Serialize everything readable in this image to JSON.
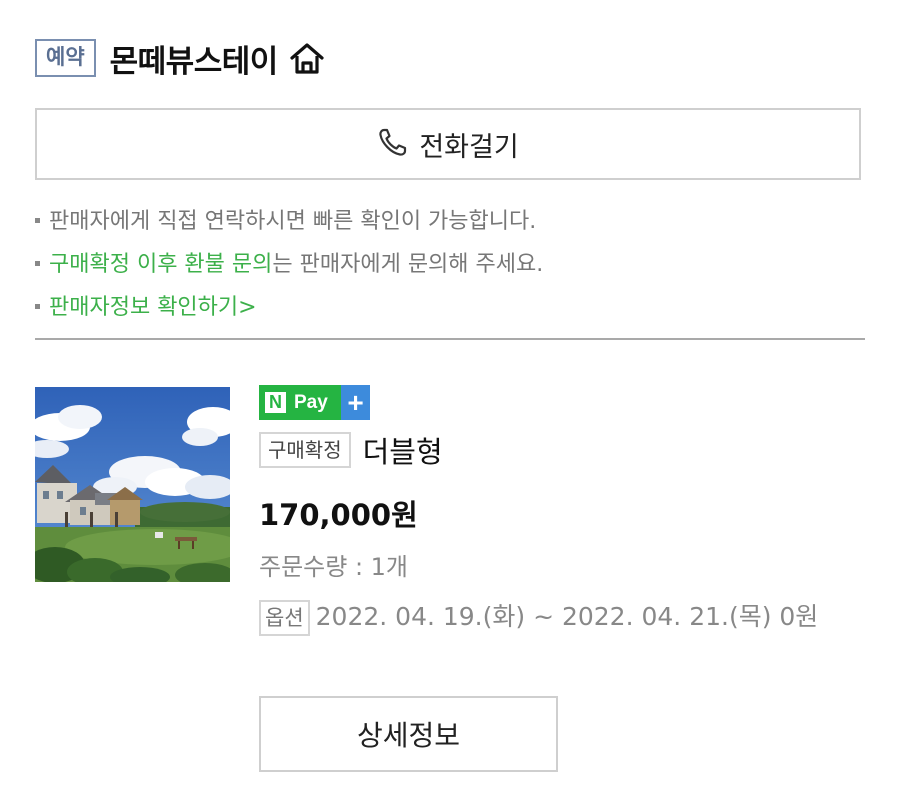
{
  "header": {
    "badge": "예약",
    "store_name": "몬떼뷰스테이",
    "home_icon": "home-icon"
  },
  "call_button": {
    "label": "전화걸기",
    "icon": "phone-icon"
  },
  "notes": {
    "line1": "판매자에게 직접 연락하시면 빠른 확인이 가능합니다.",
    "line2_highlight": "구매확정 이후 환불 문의",
    "line2_rest": "는 판매자에게 문의해 주세요.",
    "line3_link": "판매자정보 확인하기",
    "line3_arrow": ">"
  },
  "colors": {
    "accent_green": "#3cb04a",
    "npay_green": "#25b442",
    "npay_plus_blue": "#3d8bdc",
    "badge_border": "#7a8fb0"
  },
  "product": {
    "npay": {
      "n": "N",
      "pay": "Pay",
      "plus": "+"
    },
    "status": "구매확정",
    "name": "더블형",
    "price": "170,000원",
    "quantity": "주문수량 : 1개",
    "option_label": "옵션",
    "option_value": "2022. 04. 19.(화) ~ 2022. 04. 21.(목) 0원"
  },
  "detail_button": {
    "label": "상세정보"
  }
}
